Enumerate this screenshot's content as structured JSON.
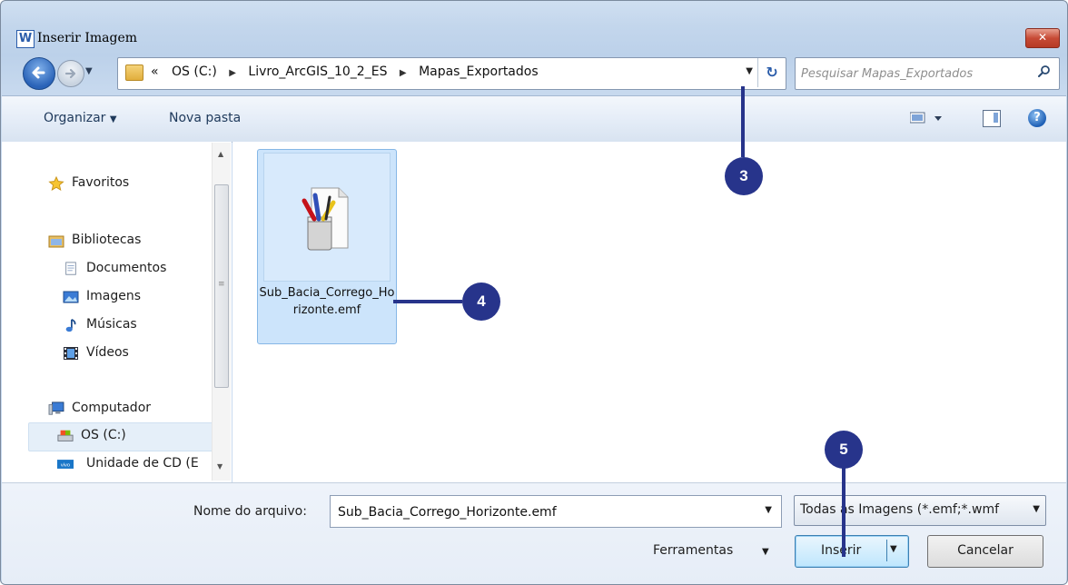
{
  "window": {
    "title": "Inserir Imagem",
    "app_icon": "W",
    "close_icon": "close-icon"
  },
  "nav": {
    "back_icon": "back-arrow-icon",
    "forward_icon": "forward-arrow-icon",
    "breadcrumb_prefix": "«",
    "crumbs": [
      "OS (C:)",
      "Livro_ArcGIS_10_2_ES",
      "Mapas_Exportados"
    ],
    "search_placeholder": "Pesquisar Mapas_Exportados"
  },
  "toolbar": {
    "organize": "Organizar",
    "new_folder": "Nova pasta"
  },
  "sidebar": {
    "favorites": "Favoritos",
    "libraries": "Bibliotecas",
    "documents": "Documentos",
    "images": "Imagens",
    "music": "Músicas",
    "videos": "Vídeos",
    "computer": "Computador",
    "drive_c": "OS (C:)",
    "cd_drive": "Unidade de CD (E"
  },
  "files": [
    {
      "name": "Sub_Bacia_Corrego_Horizonte.emf",
      "icon": "emf-file-icon"
    }
  ],
  "bottom": {
    "filename_label": "Nome do arquivo:",
    "filename_value": "Sub_Bacia_Corrego_Horizonte.emf",
    "filetype_value": "Todas as Imagens (*.emf;*.wmf",
    "tools_label": "Ferramentas",
    "insert_label": "Inserir",
    "cancel_label": "Cancelar"
  },
  "callouts": [
    "3",
    "4",
    "5"
  ],
  "colors": {
    "callout": "#27348b",
    "selection": "#cce4fb",
    "toolbar_text": "#1e395b"
  }
}
